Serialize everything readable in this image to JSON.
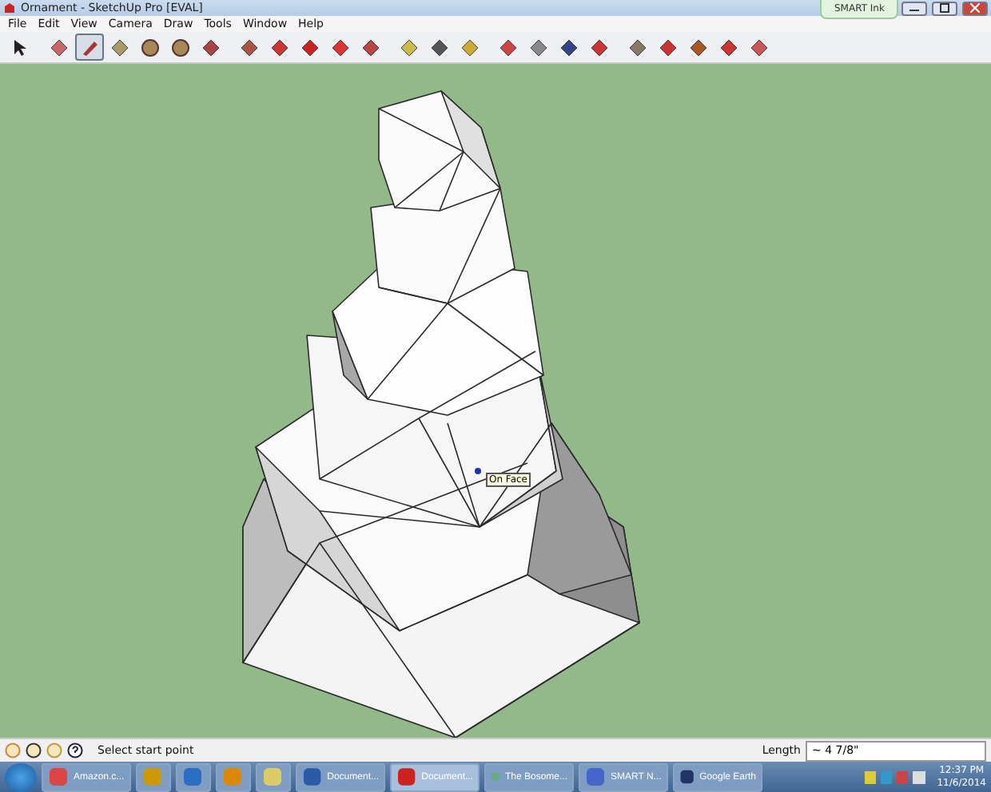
{
  "window": {
    "title": "Ornament - SketchUp Pro [EVAL]"
  },
  "smart_ink": {
    "label": "SMART Ink"
  },
  "menu": [
    "File",
    "Edit",
    "View",
    "Camera",
    "Draw",
    "Tools",
    "Window",
    "Help"
  ],
  "toolbar": [
    {
      "selected": false
    },
    {
      "selected": false
    },
    {
      "selected": true
    },
    {
      "selected": false
    },
    {
      "selected": false
    },
    {
      "selected": false
    },
    {
      "selected": false
    },
    {
      "selected": false
    },
    {
      "selected": false
    },
    {
      "selected": false
    },
    {
      "selected": false
    },
    {
      "selected": false
    },
    {
      "selected": false
    },
    {
      "selected": false
    },
    {
      "selected": false
    },
    {
      "selected": false
    },
    {
      "selected": false
    },
    {
      "selected": false
    },
    {
      "selected": false
    },
    {
      "selected": false
    },
    {
      "selected": false
    },
    {
      "selected": false
    },
    {
      "selected": false
    },
    {
      "selected": false
    }
  ],
  "tooltip": {
    "text": "On Face"
  },
  "status_bar": {
    "message": "Select start point",
    "measure_label": "Length",
    "measure_value": "~ 4 7/8\""
  },
  "taskbar": {
    "apps": [
      {
        "label": "Amazon.c...",
        "selected": false
      },
      {
        "selected": false
      },
      {
        "selected": false
      },
      {
        "selected": false
      },
      {
        "selected": false
      },
      {
        "label": "Document...",
        "selected": false
      },
      {
        "label": "Document...",
        "selected": true
      },
      {
        "label": "The Bosome...",
        "selected": false
      },
      {
        "label": "SMART N...",
        "selected": false
      },
      {
        "label": "Google Earth",
        "selected": false
      }
    ],
    "time": "12:37 PM",
    "date": "11/6/2014"
  }
}
